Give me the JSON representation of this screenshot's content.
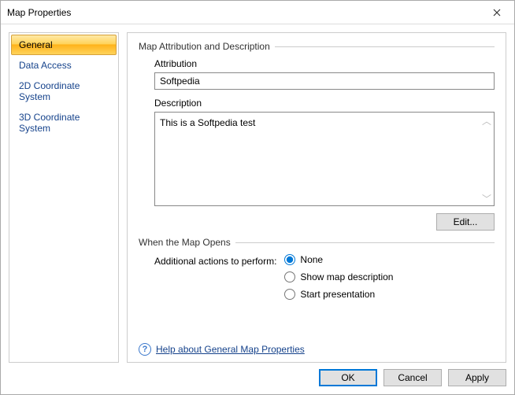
{
  "window": {
    "title": "Map Properties"
  },
  "sidebar": {
    "items": [
      {
        "label": "General",
        "selected": true
      },
      {
        "label": "Data Access",
        "selected": false
      },
      {
        "label": "2D Coordinate System",
        "selected": false
      },
      {
        "label": "3D Coordinate System",
        "selected": false
      }
    ]
  },
  "section1": {
    "legend": "Map Attribution and Description",
    "attr_label": "Attribution",
    "attr_value": "Softpedia",
    "desc_label": "Description",
    "desc_value": "This is a Softpedia test",
    "edit_btn": "Edit..."
  },
  "section2": {
    "legend": "When the Map Opens",
    "actions_label": "Additional actions to perform:",
    "options": {
      "none": "None",
      "show": "Show map description",
      "start": "Start presentation"
    },
    "selected": "none"
  },
  "help": {
    "text": "Help about General Map Properties"
  },
  "footer": {
    "ok": "OK",
    "cancel": "Cancel",
    "apply": "Apply"
  }
}
